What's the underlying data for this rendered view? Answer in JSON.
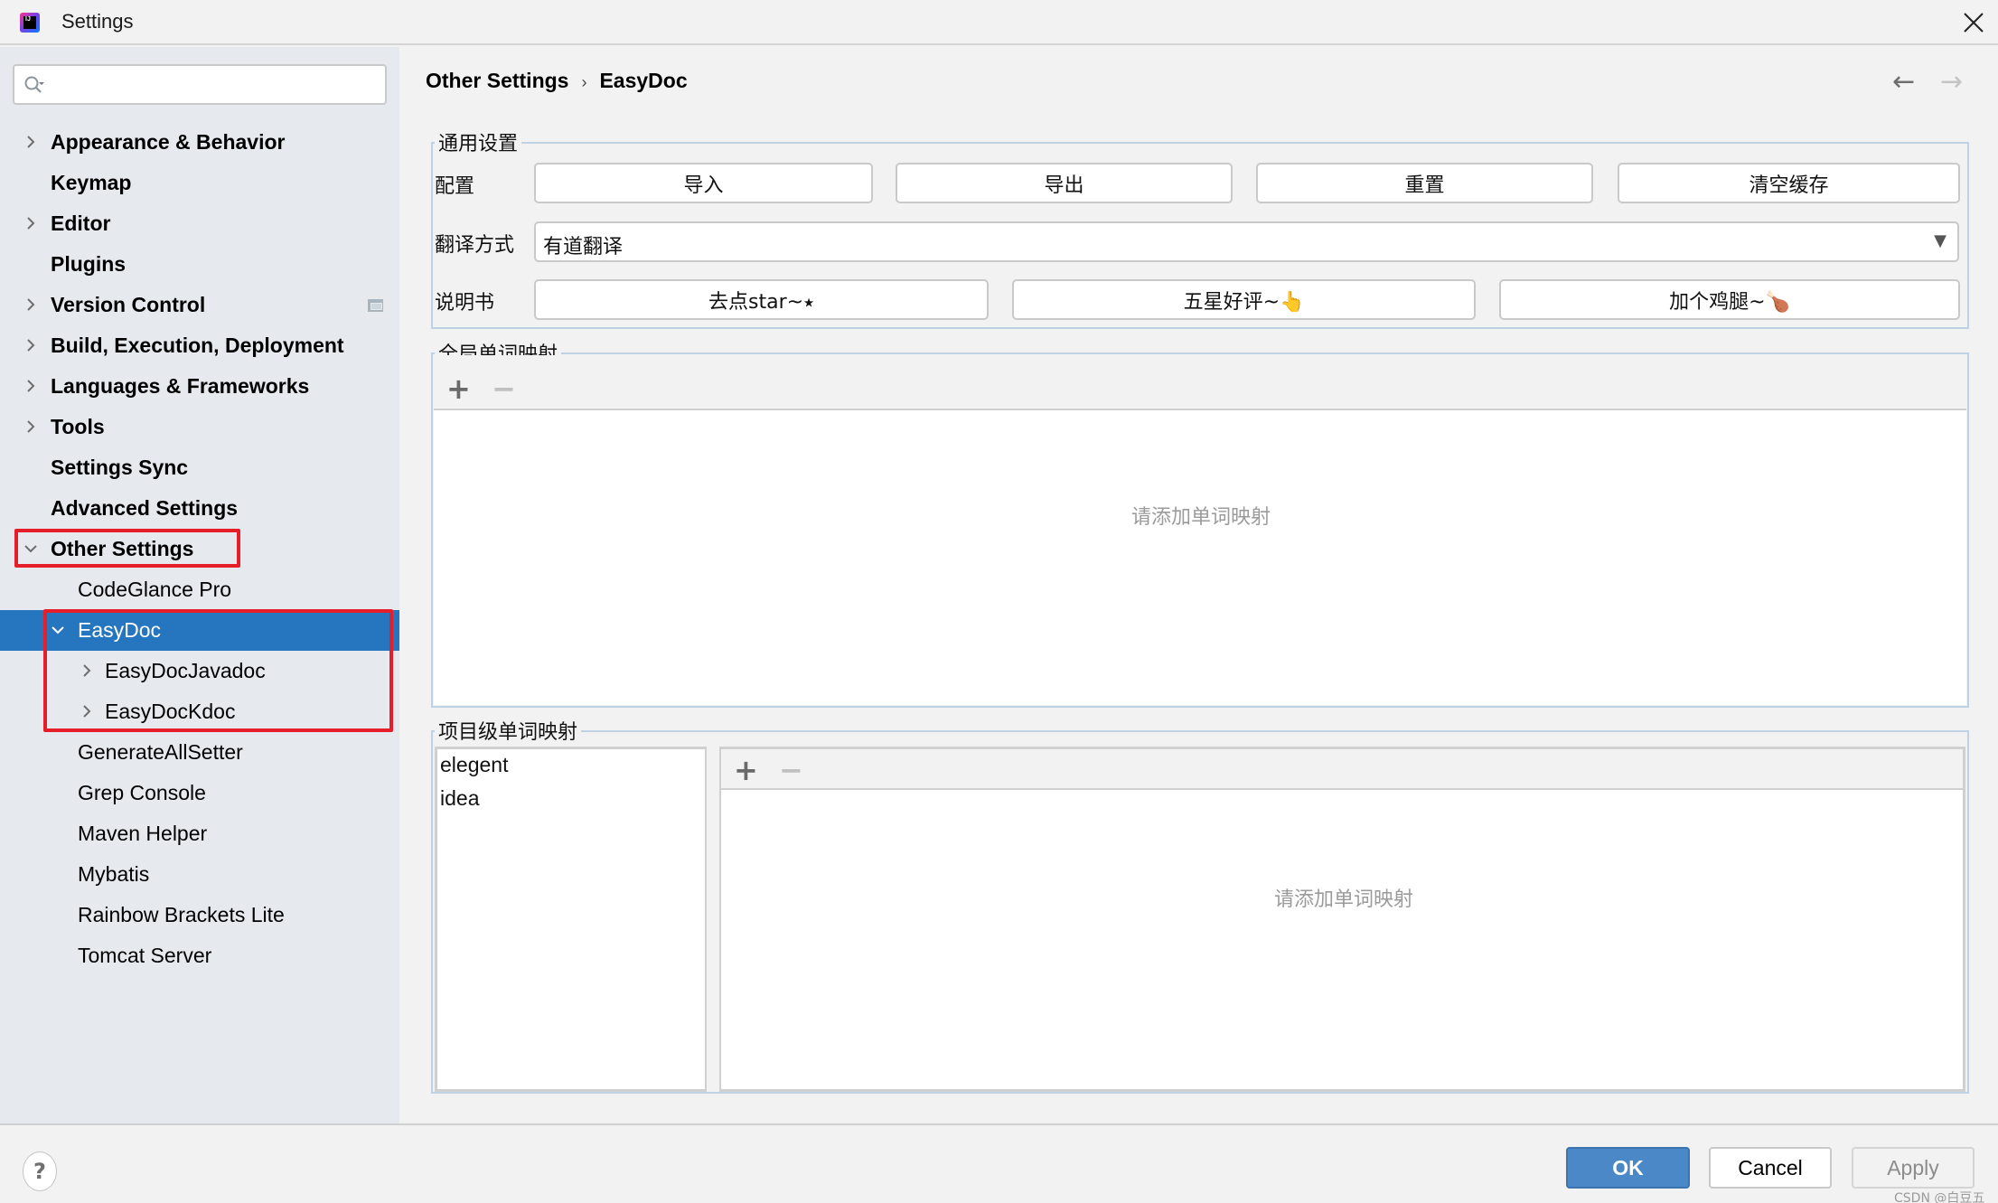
{
  "window": {
    "title": "Settings",
    "close_icon": "close-icon",
    "app_icon": "intellij-idea-icon"
  },
  "sidebar": {
    "search": {
      "value": "",
      "placeholder": "",
      "icon": "search-icon"
    },
    "items": [
      {
        "label": "Appearance & Behavior",
        "level": 0,
        "expandable": true,
        "expanded": false,
        "bold": true
      },
      {
        "label": "Keymap",
        "level": 0,
        "expandable": false,
        "bold": true
      },
      {
        "label": "Editor",
        "level": 0,
        "expandable": true,
        "expanded": false,
        "bold": true
      },
      {
        "label": "Plugins",
        "level": 0,
        "expandable": false,
        "bold": true
      },
      {
        "label": "Version Control",
        "level": 0,
        "expandable": true,
        "expanded": false,
        "bold": true,
        "badge_icon": "project-scope-icon"
      },
      {
        "label": "Build, Execution, Deployment",
        "level": 0,
        "expandable": true,
        "expanded": false,
        "bold": true
      },
      {
        "label": "Languages & Frameworks",
        "level": 0,
        "expandable": true,
        "expanded": false,
        "bold": true
      },
      {
        "label": "Tools",
        "level": 0,
        "expandable": true,
        "expanded": false,
        "bold": true
      },
      {
        "label": "Settings Sync",
        "level": 0,
        "expandable": false,
        "bold": true
      },
      {
        "label": "Advanced Settings",
        "level": 0,
        "expandable": false,
        "bold": true
      },
      {
        "label": "Other Settings",
        "level": 0,
        "expandable": true,
        "expanded": true,
        "bold": true,
        "highlighted": true
      },
      {
        "label": "CodeGlance Pro",
        "level": 1,
        "expandable": false
      },
      {
        "label": "EasyDoc",
        "level": 1,
        "expandable": true,
        "expanded": true,
        "selected": true,
        "highlighted": true
      },
      {
        "label": "EasyDocJavadoc",
        "level": 2,
        "expandable": true,
        "expanded": false,
        "highlighted": true
      },
      {
        "label": "EasyDocKdoc",
        "level": 2,
        "expandable": true,
        "expanded": false,
        "highlighted": true
      },
      {
        "label": "GenerateAllSetter",
        "level": 1,
        "expandable": false
      },
      {
        "label": "Grep Console",
        "level": 1,
        "expandable": false
      },
      {
        "label": "Maven Helper",
        "level": 1,
        "expandable": false
      },
      {
        "label": "Mybatis",
        "level": 1,
        "expandable": false
      },
      {
        "label": "Rainbow Brackets Lite",
        "level": 1,
        "expandable": false
      },
      {
        "label": "Tomcat Server",
        "level": 1,
        "expandable": false
      }
    ]
  },
  "breadcrumb": {
    "parent": "Other Settings",
    "separator": "›",
    "current": "EasyDoc",
    "back_icon": "arrow-left-icon",
    "forward_icon": "arrow-right-icon",
    "back_symbol": "←",
    "forward_symbol": "→"
  },
  "general": {
    "legend": "通用设置",
    "config_label": "配置",
    "config_buttons": [
      "导入",
      "导出",
      "重置",
      "清空缓存"
    ],
    "translate_label": "翻译方式",
    "translate_value": "有道翻译",
    "manual_label": "说明书",
    "manual_buttons": [
      "去点star~⭑",
      "五星好评~👆",
      "加个鸡腿~🍗"
    ]
  },
  "global_mapping": {
    "legend": "全局单词映射",
    "add_symbol": "+",
    "remove_symbol": "−",
    "empty_text": "请添加单词映射"
  },
  "project_mapping": {
    "legend": "项目级单词映射",
    "projects": [
      "elegent",
      "idea"
    ],
    "add_symbol": "+",
    "remove_symbol": "−",
    "empty_text": "请添加单词映射"
  },
  "footer": {
    "help_symbol": "?",
    "ok": "OK",
    "cancel": "Cancel",
    "apply": "Apply",
    "watermark": "CSDN @白豆五"
  },
  "colors": {
    "accent": "#2675bf",
    "ok_button": "#4a88c7",
    "highlight_box": "#e51e2a",
    "sidebar_bg": "#e6eaef"
  }
}
